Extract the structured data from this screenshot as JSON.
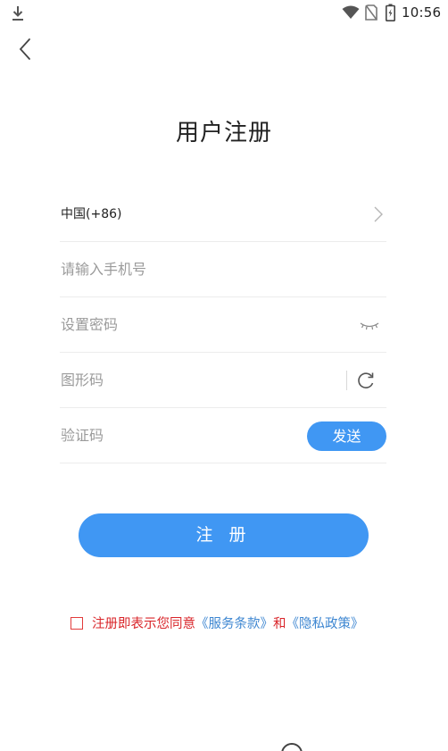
{
  "status_bar": {
    "time": "10:56",
    "icons": [
      "download-icon",
      "wifi-icon",
      "no-sim-icon",
      "battery-charging-icon"
    ]
  },
  "header": {
    "back_icon": "chevron-left-icon",
    "title": "用户注册"
  },
  "form": {
    "country_code": "中国(+86)",
    "phone_placeholder": "请输入手机号",
    "phone_value": "",
    "password_placeholder": "设置密码",
    "password_value": "",
    "captcha_placeholder": "图形码",
    "captcha_value": "",
    "sms_code_placeholder": "验证码",
    "sms_code_value": "",
    "send_label": "发送"
  },
  "register_label": "注 册",
  "agreement": {
    "checked": false,
    "prefix": "注册即表示您同意",
    "terms_link": "《服务条款》",
    "conjunction": "和",
    "privacy_link": "《隐私政策》"
  },
  "colors": {
    "accent": "#4097f3",
    "warning_red": "#d9252a",
    "link_blue": "#3d86d1"
  }
}
